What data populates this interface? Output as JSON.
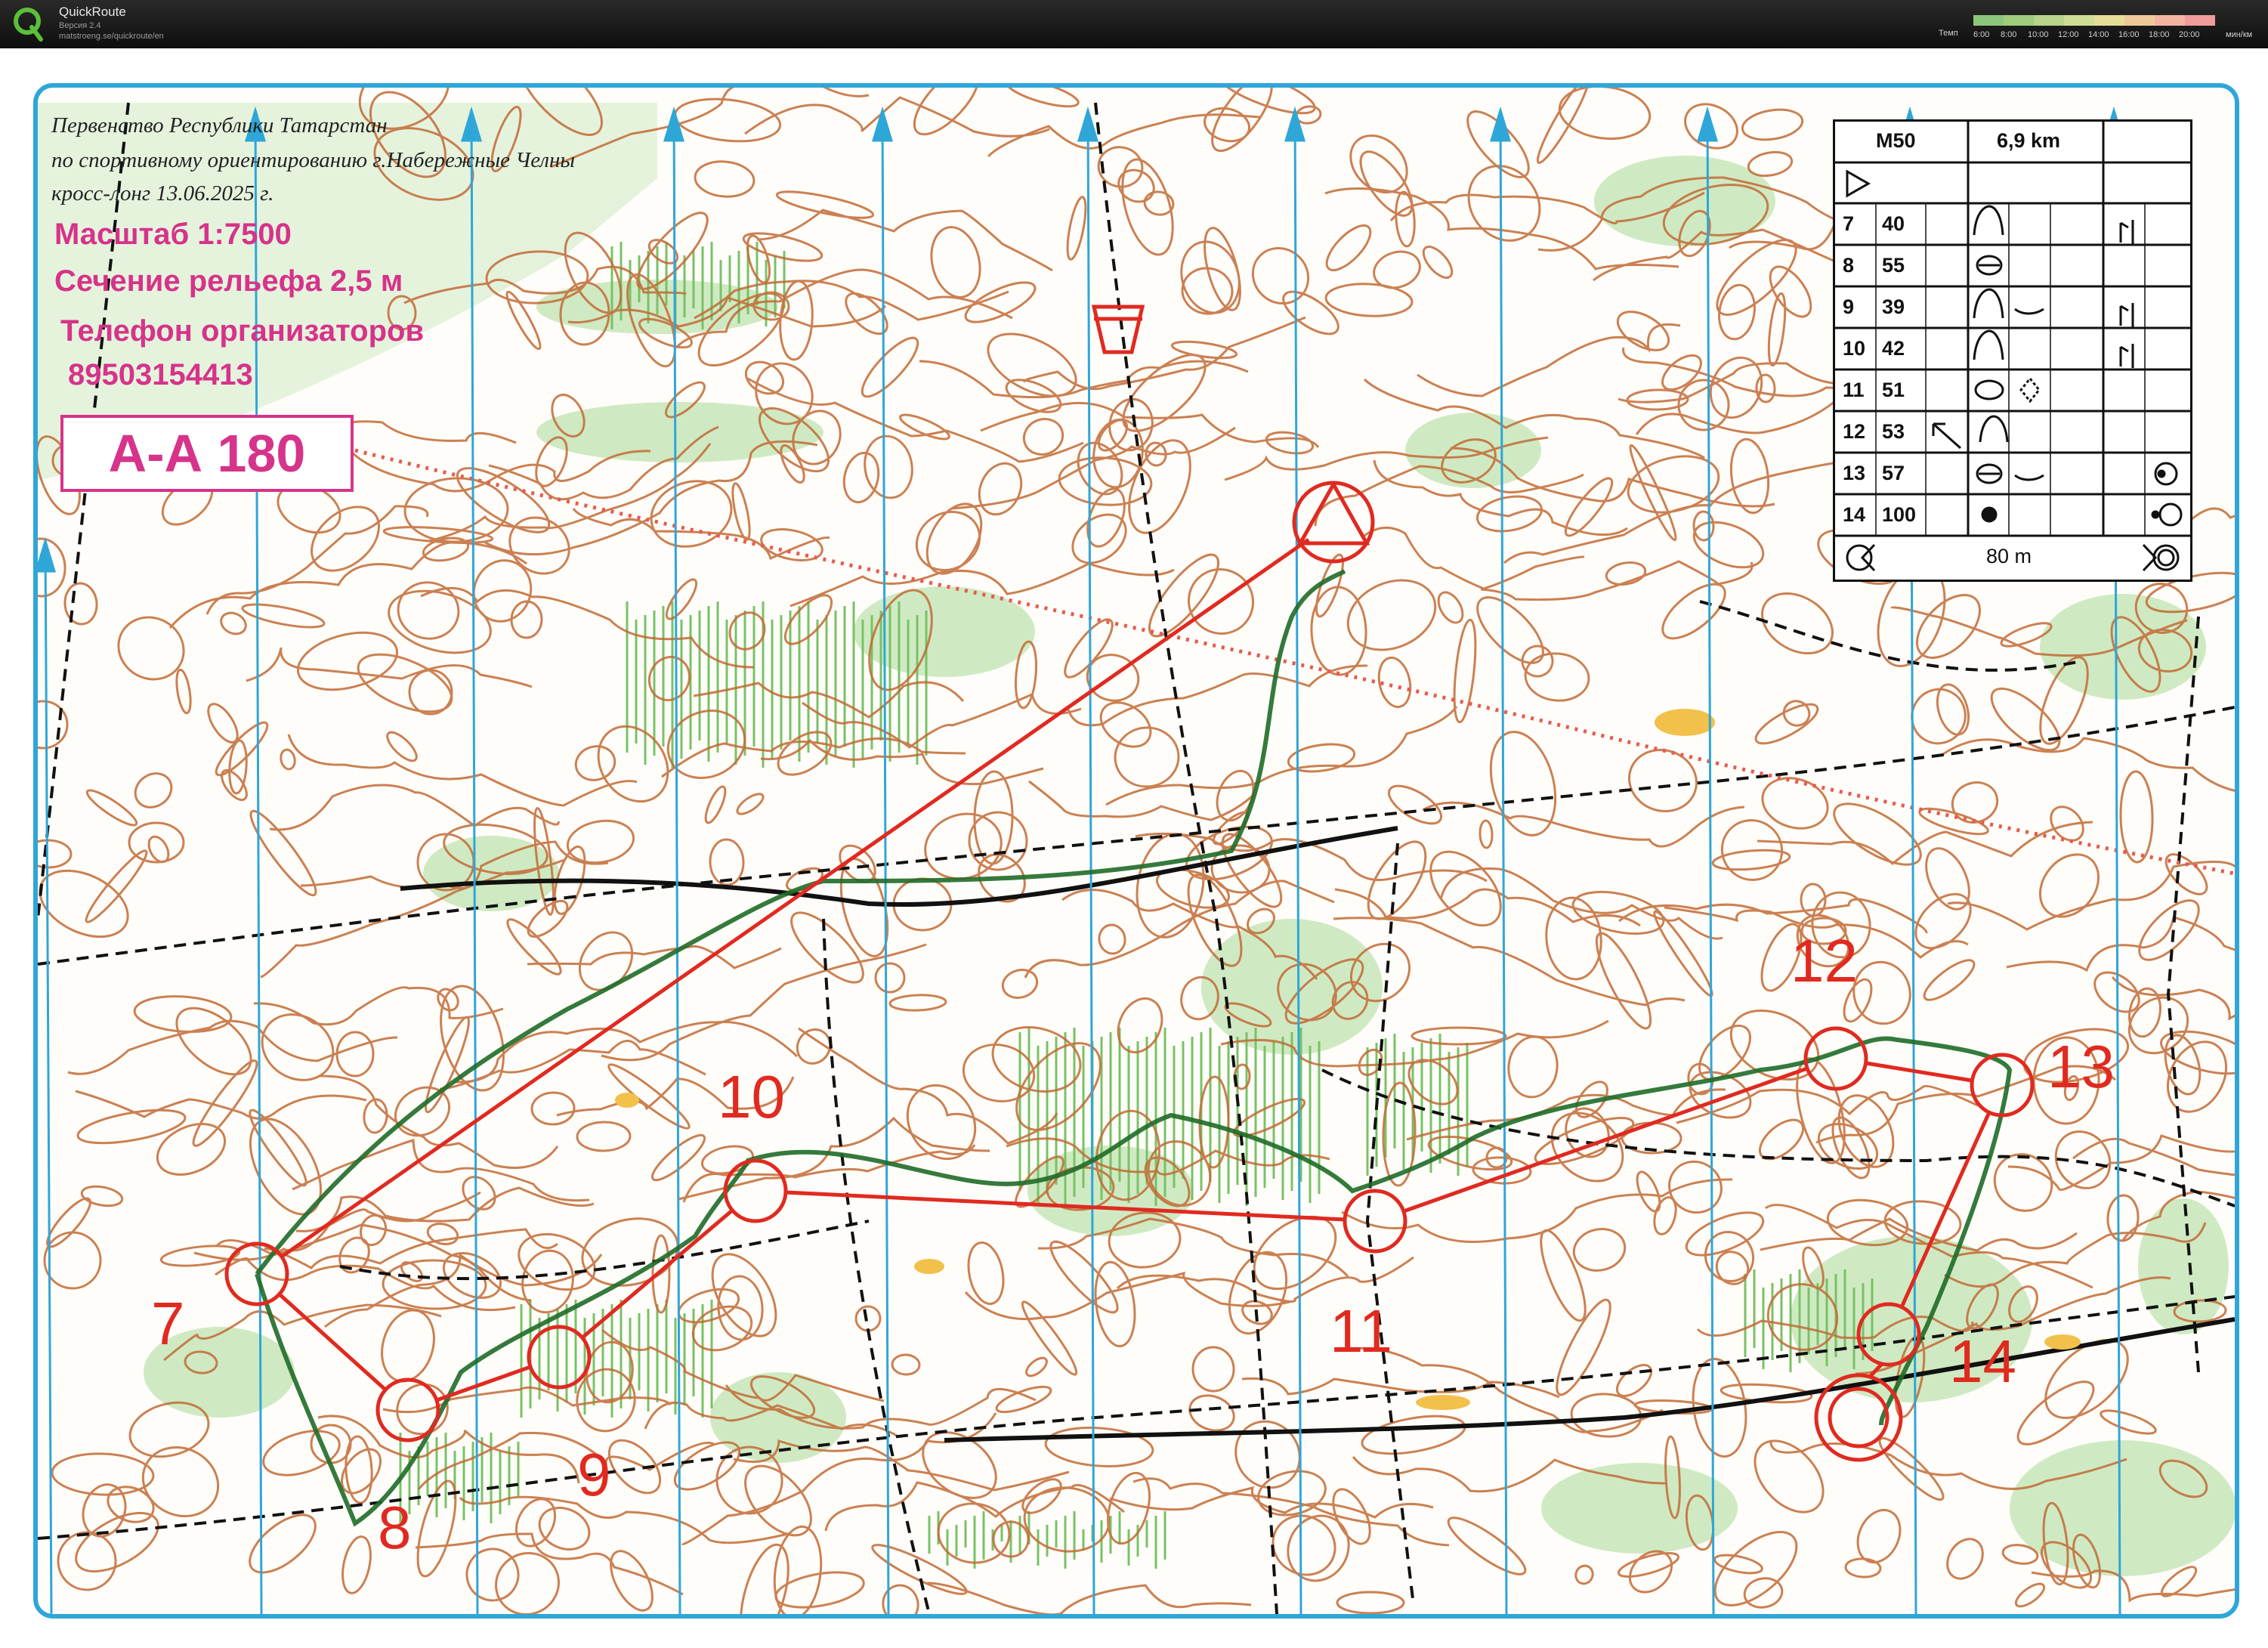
{
  "app": {
    "title": "QuickRoute",
    "version": "Версия 2.4",
    "url": "matstroeng.se/quickroute/en",
    "legend": {
      "label": "Темп",
      "ticks": [
        "6:00",
        "8:00",
        "10:00",
        "12:00",
        "14:00",
        "16:00",
        "18:00",
        "20:00"
      ],
      "unit": "мин/км",
      "colors": [
        "#8bc67b",
        "#9dcc7d",
        "#b6d48a",
        "#cfdd94",
        "#e5dc98",
        "#efc89a",
        "#f2b4a0",
        "#f09c9c"
      ]
    }
  },
  "map": {
    "header_lines": [
      "Первенство Республики Татарстан",
      "по спортивному ориентированию  г.Набережные Челны",
      "кросс-лонг 13.06.2025 г."
    ],
    "scale_text": "Масштаб 1:7500",
    "contour_text": "Сечение рельефа 2,5 м",
    "phone_label": "Телефон организаторов",
    "phone_number": "89503154413",
    "map_id": "А-А 180",
    "colors": {
      "course": "#e02a20",
      "north_lines": "#2fa6d8",
      "contours": "#b5532a",
      "vegetation": "#bfe3b0",
      "magenta": "#d6338a",
      "route": "#1f6b28"
    },
    "controls": [
      {
        "number": "7"
      },
      {
        "number": "8"
      },
      {
        "number": "9"
      },
      {
        "number": "10"
      },
      {
        "number": "11"
      },
      {
        "number": "12"
      },
      {
        "number": "13"
      },
      {
        "number": "14"
      }
    ]
  },
  "descriptions": {
    "class": "M50",
    "length": "6,9 km",
    "rows": [
      {
        "no": "7",
        "code": "40"
      },
      {
        "no": "8",
        "code": "55"
      },
      {
        "no": "9",
        "code": "39"
      },
      {
        "no": "10",
        "code": "42"
      },
      {
        "no": "11",
        "code": "51"
      },
      {
        "no": "12",
        "code": "53"
      },
      {
        "no": "13",
        "code": "57"
      },
      {
        "no": "14",
        "code": "100"
      }
    ],
    "finish_distance": "80 m"
  }
}
